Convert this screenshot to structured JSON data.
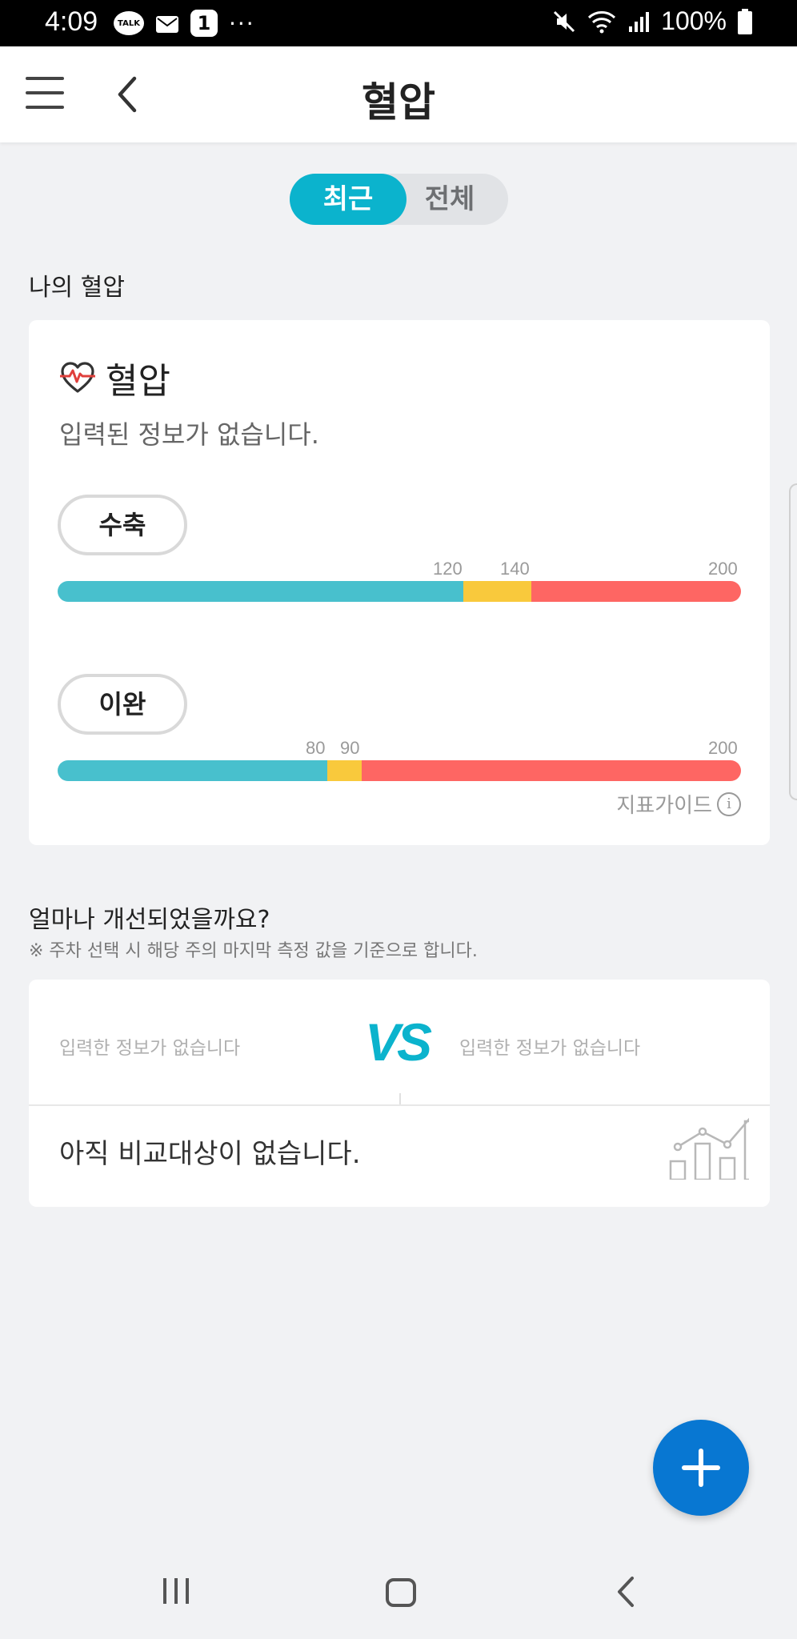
{
  "status_bar": {
    "time": "4:09",
    "talk_label": "TALK",
    "badge_count": "1",
    "more": "···",
    "battery": "100%"
  },
  "app_bar": {
    "title": "혈압"
  },
  "tabs": {
    "recent": "최근",
    "all": "전체",
    "selected": "recent"
  },
  "my_bp": {
    "section_title": "나의 혈압",
    "card_title": "혈압",
    "empty_message": "입력된 정보가 없습니다.",
    "systolic": {
      "label": "수축",
      "thresholds": [
        "120",
        "140",
        "200"
      ],
      "normal_max": 120,
      "warn_max": 140,
      "max": 200
    },
    "diastolic": {
      "label": "이완",
      "thresholds": [
        "80",
        "90",
        "200"
      ],
      "normal_max": 80,
      "warn_max": 90,
      "max": 200
    },
    "guide_label": "지표가이드",
    "info_glyph": "i"
  },
  "improvement": {
    "section_title": "얼마나 개선되었을까요?",
    "note": "※ 주차 선택 시 해당 주의 마지막 측정 값을 기준으로 합니다.",
    "left_empty": "입력한 정보가 없습니다",
    "vs": "VS",
    "right_empty": "입력한 정보가 없습니다",
    "no_comparison": "아직 비교대상이 없습니다."
  },
  "colors": {
    "accent": "#0bb3cd",
    "fab": "#0877d2",
    "normal": "#48c0cd",
    "warning": "#f9c93c",
    "danger": "#fe6663",
    "heart": "#e0403c"
  },
  "icons": {
    "menu": "hamburger-icon",
    "back": "chevron-left-icon",
    "heart": "heart-pulse-icon",
    "info": "info-icon",
    "graph": "bar-line-chart-icon",
    "add": "plus-icon"
  }
}
